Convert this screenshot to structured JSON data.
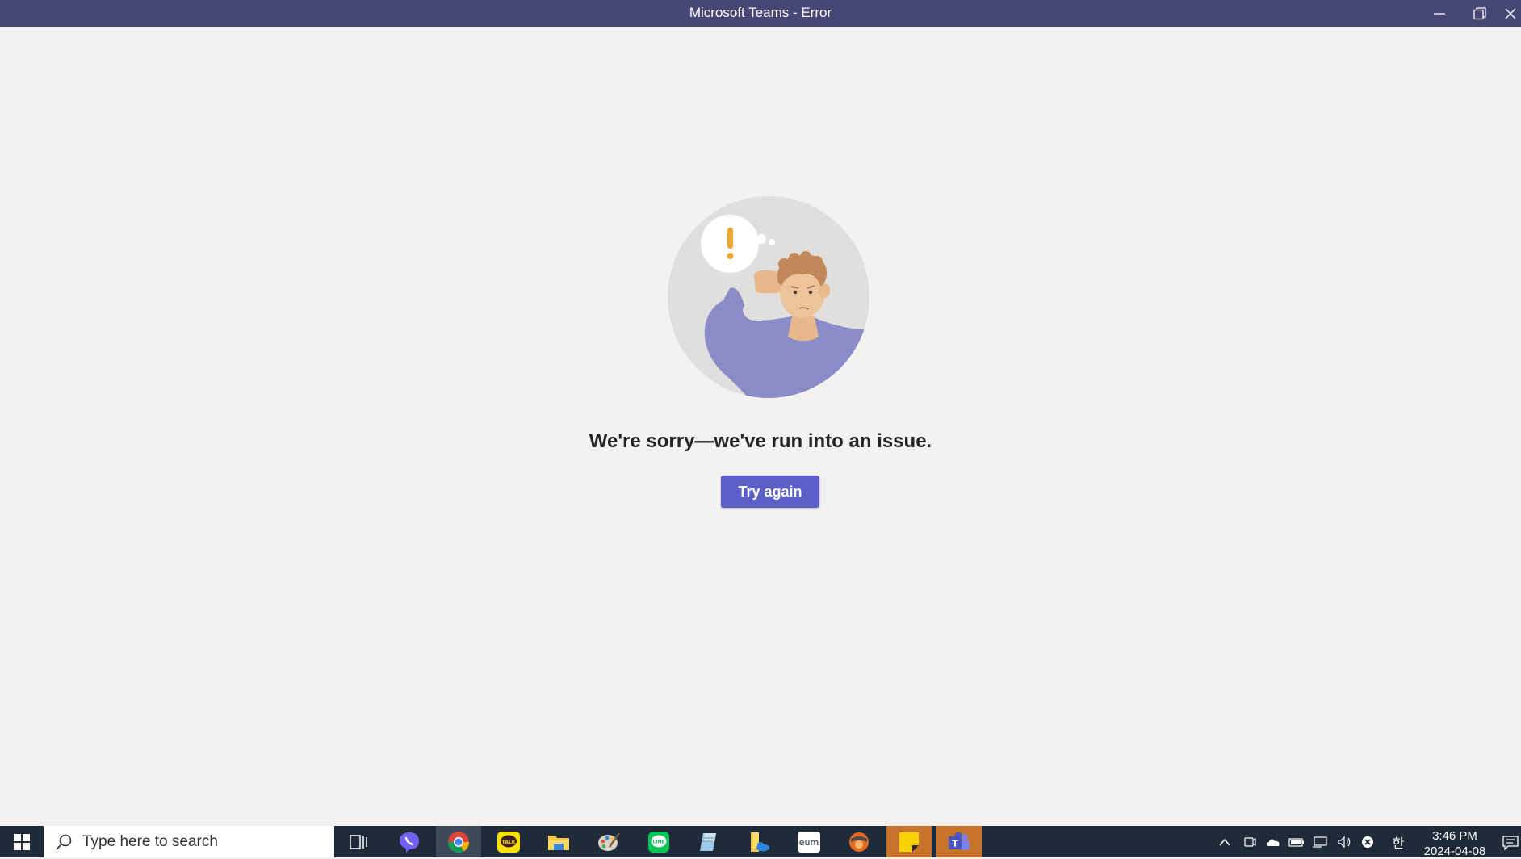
{
  "window": {
    "title": "Microsoft Teams - Error",
    "controls": [
      "minimize-icon",
      "restore-icon",
      "close-icon"
    ]
  },
  "error": {
    "message": "We're sorry—we've run into an issue.",
    "retry_label": "Try again"
  },
  "taskbar": {
    "search_placeholder": "Type here to search",
    "pinned_apps": [
      "task-view",
      "viber",
      "chrome",
      "kakaotalk",
      "file-explorer",
      "paint",
      "line",
      "notepad",
      "onedrive-folder",
      "eum",
      "orange-app",
      "sticky-notes",
      "teams"
    ],
    "clock": {
      "time": "3:46 PM",
      "date": "2024-04-08"
    },
    "ime": "한"
  },
  "colors": {
    "titlebar": "#464775",
    "accent": "#5b5fc7",
    "taskbar": "#1f2b38",
    "background": "#f3f2f1"
  }
}
